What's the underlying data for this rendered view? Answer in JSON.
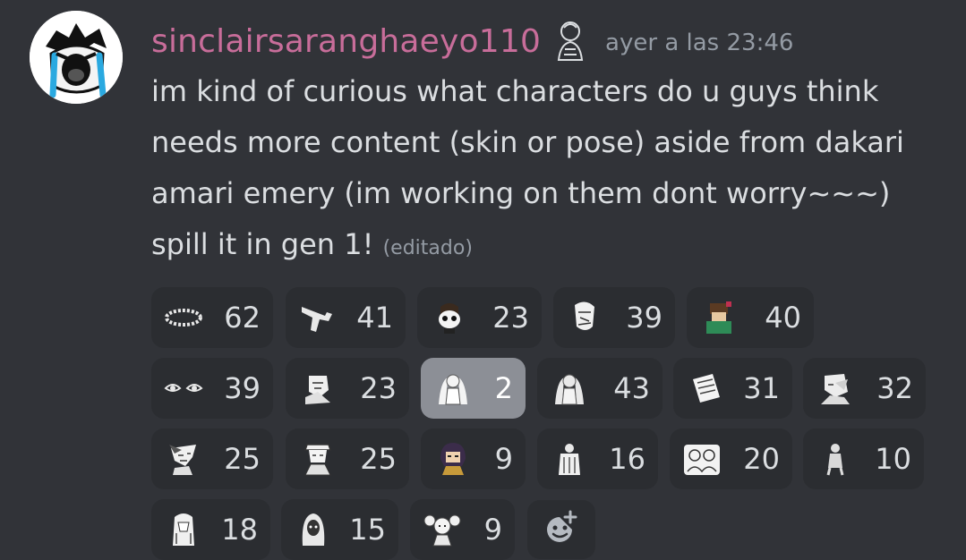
{
  "message": {
    "username": "sinclairsaranghaeyo110",
    "timestamp": "ayer a las 23:46",
    "text": "im kind of curious what characters do u guys think needs more content (skin or pose) aside from dakari amari emery (im working on them dont worry~~~) spill it in gen 1!",
    "edited_label": "(editado)",
    "username_color": "#c86d9a"
  },
  "reactions": [
    {
      "emoji": "ring-emoji",
      "count": "62"
    },
    {
      "emoji": "gun-emoji",
      "count": "41"
    },
    {
      "emoji": "skull-face-emoji",
      "count": "23"
    },
    {
      "emoji": "angel-sketch-emoji",
      "count": "39"
    },
    {
      "emoji": "green-character-emoji",
      "count": "40"
    },
    {
      "emoji": "eyes-emoji",
      "count": "39"
    },
    {
      "emoji": "thinking-character-emoji",
      "count": "23"
    },
    {
      "emoji": "praying-angel-emoji",
      "count": "2",
      "active": true
    },
    {
      "emoji": "praying-angel-emoji",
      "count": "43"
    },
    {
      "emoji": "paper-note-emoji",
      "count": "31"
    },
    {
      "emoji": "facepalm-character-emoji",
      "count": "32"
    },
    {
      "emoji": "smirk-character-emoji",
      "count": "25"
    },
    {
      "emoji": "hat-character-emoji",
      "count": "25"
    },
    {
      "emoji": "dark-hair-character-emoji",
      "count": "9"
    },
    {
      "emoji": "standing-character-emoji",
      "count": "16"
    },
    {
      "emoji": "group-sketch-emoji",
      "count": "20"
    },
    {
      "emoji": "small-figure-emoji",
      "count": "10"
    },
    {
      "emoji": "long-hair-character-emoji",
      "count": "18"
    },
    {
      "emoji": "hooded-character-emoji",
      "count": "15"
    },
    {
      "emoji": "twin-tail-character-emoji",
      "count": "9"
    }
  ],
  "add_reaction_icon": "add-reaction-icon"
}
